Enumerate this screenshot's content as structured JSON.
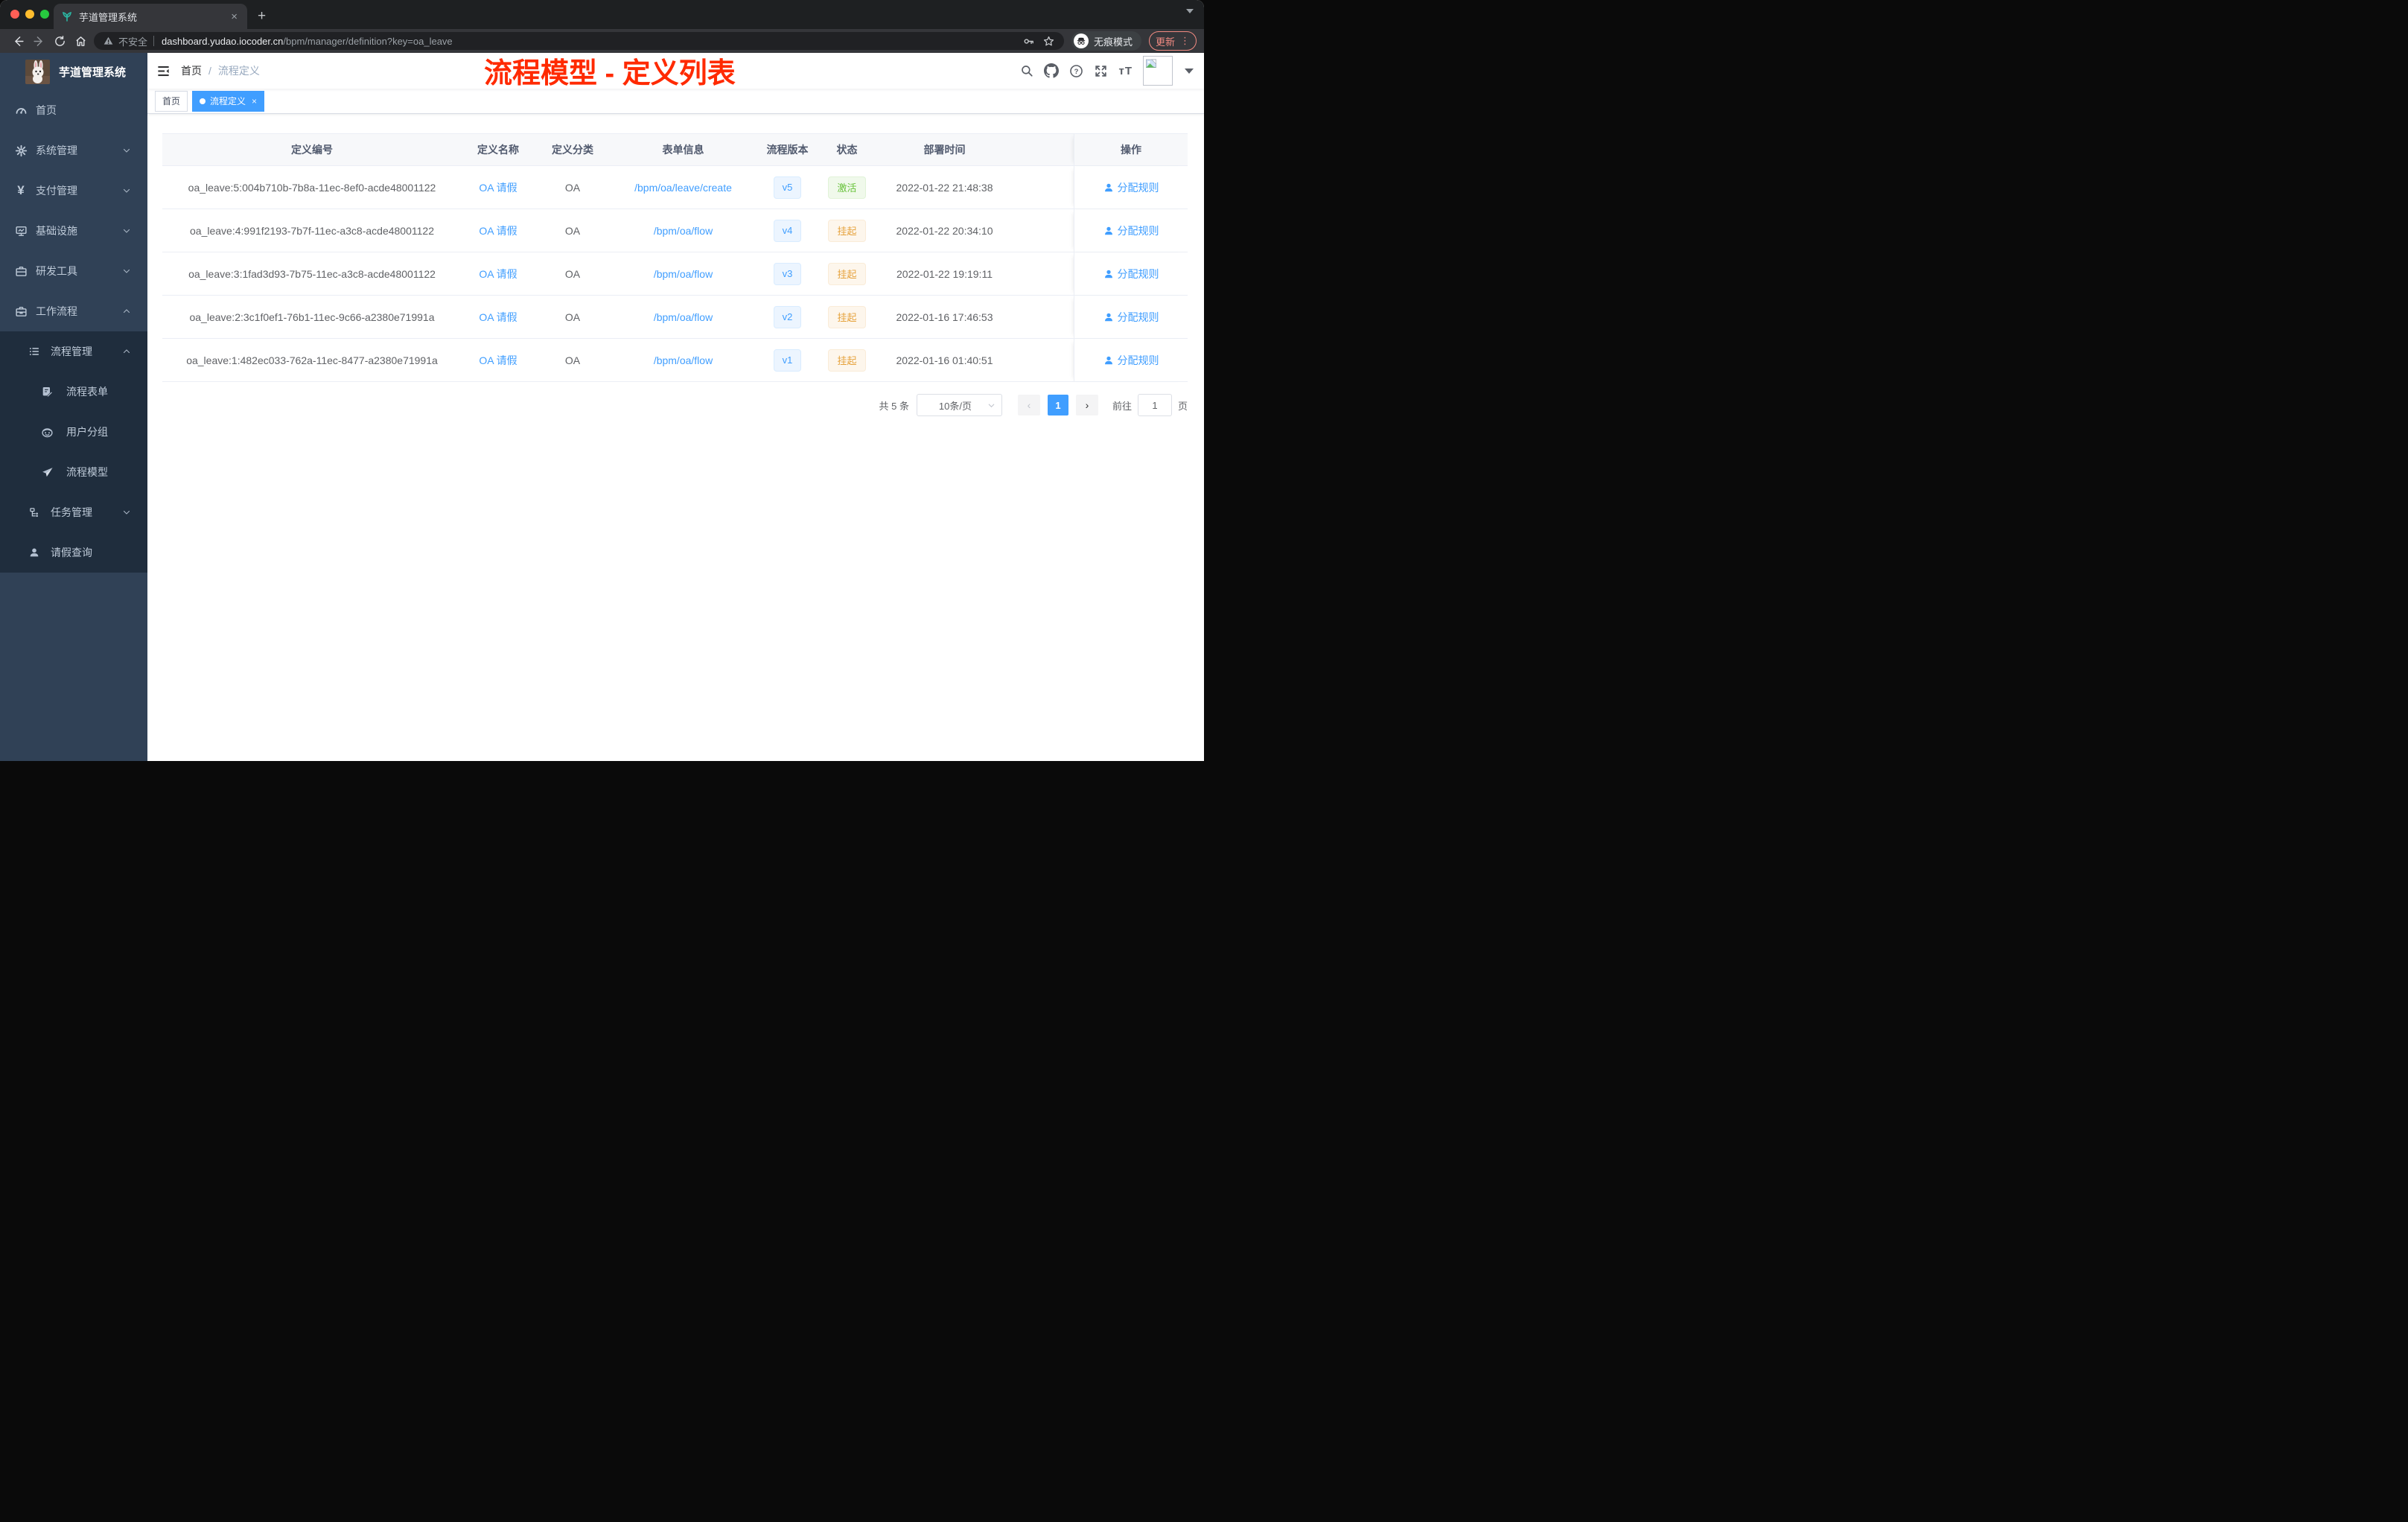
{
  "colors": {
    "accent": "#409eff",
    "annotation_red": "#ff2a00",
    "status_active": "#67c23a",
    "status_suspended": "#e6a23c",
    "sidebar_bg": "#304156",
    "submenu_bg": "#1f2d3d"
  },
  "browser": {
    "tab_title": "芋道管理系统",
    "tab_close": "×",
    "new_tab": "+",
    "back": "←",
    "forward": "→",
    "security_label": "不安全",
    "url_host": "dashboard.yudao.iocoder.cn",
    "url_path": "/bpm/manager/definition?key=oa_leave",
    "incognito_label": "无痕模式",
    "update_label": "更新",
    "menu_dots": "⋮"
  },
  "sidebar": {
    "logo_title": "芋道管理系统",
    "items": [
      {
        "label": "首页"
      },
      {
        "label": "系统管理"
      },
      {
        "label": "支付管理"
      },
      {
        "label": "基础设施"
      },
      {
        "label": "研发工具"
      },
      {
        "label": "工作流程"
      },
      {
        "label": "流程管理"
      },
      {
        "label": "流程表单"
      },
      {
        "label": "用户分组"
      },
      {
        "label": "流程模型"
      },
      {
        "label": "任务管理"
      },
      {
        "label": "请假查询"
      }
    ]
  },
  "header": {
    "breadcrumb_home": "首页",
    "breadcrumb_separator": "/",
    "breadcrumb_current": "流程定义",
    "annotation": "流程模型 - 定义列表"
  },
  "tags": {
    "home": "首页",
    "current": "流程定义",
    "close": "×"
  },
  "table": {
    "columns": [
      "定义编号",
      "定义名称",
      "定义分类",
      "表单信息",
      "流程版本",
      "状态",
      "部署时间",
      "操作"
    ],
    "rows": [
      {
        "id": "oa_leave:5:004b710b-7b8a-11ec-8ef0-acde48001122",
        "name": "OA 请假",
        "category": "OA",
        "form": "/bpm/oa/leave/create",
        "version": "v5",
        "status": "激活",
        "time": "2022-01-22 21:48:38",
        "action": "分配规则"
      },
      {
        "id": "oa_leave:4:991f2193-7b7f-11ec-a3c8-acde48001122",
        "name": "OA 请假",
        "category": "OA",
        "form": "/bpm/oa/flow",
        "version": "v4",
        "status": "挂起",
        "time": "2022-01-22 20:34:10",
        "action": "分配规则"
      },
      {
        "id": "oa_leave:3:1fad3d93-7b75-11ec-a3c8-acde48001122",
        "name": "OA 请假",
        "category": "OA",
        "form": "/bpm/oa/flow",
        "version": "v3",
        "status": "挂起",
        "time": "2022-01-22 19:19:11",
        "action": "分配规则"
      },
      {
        "id": "oa_leave:2:3c1f0ef1-76b1-11ec-9c66-a2380e71991a",
        "name": "OA 请假",
        "category": "OA",
        "form": "/bpm/oa/flow",
        "version": "v2",
        "status": "挂起",
        "time": "2022-01-16 17:46:53",
        "action": "分配规则"
      },
      {
        "id": "oa_leave:1:482ec033-762a-11ec-8477-a2380e71991a",
        "name": "OA 请假",
        "category": "OA",
        "form": "/bpm/oa/flow",
        "version": "v1",
        "status": "挂起",
        "time": "2022-01-16 01:40:51",
        "action": "分配规则"
      }
    ]
  },
  "pagination": {
    "total": "共 5 条",
    "page_size": "10条/页",
    "prev": "‹",
    "current_page": "1",
    "next": "›",
    "goto_label": "前往",
    "goto_value": "1",
    "goto_unit": "页"
  }
}
